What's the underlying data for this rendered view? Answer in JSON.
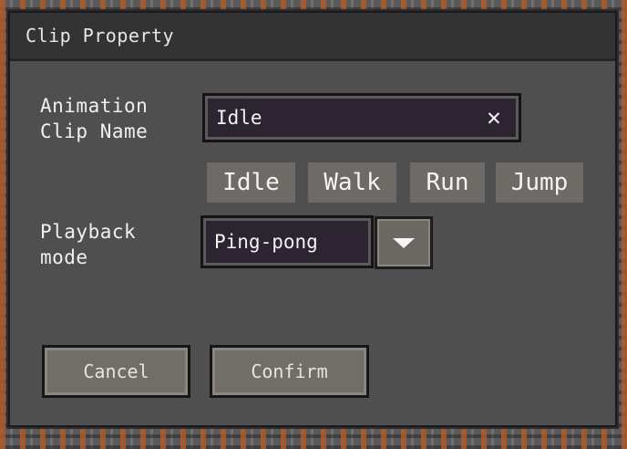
{
  "dialog": {
    "title": "Clip Property"
  },
  "clip_name": {
    "label_line1": "Animation",
    "label_line2": "Clip Name",
    "value": "Idle",
    "clear_icon": "close-icon"
  },
  "presets": [
    {
      "label": "Idle"
    },
    {
      "label": "Walk"
    },
    {
      "label": "Run"
    },
    {
      "label": "Jump"
    }
  ],
  "playback": {
    "label_line1": "Playback",
    "label_line2": "mode",
    "selected": "Ping-pong",
    "dropdown_icon": "chevron-down-icon"
  },
  "actions": {
    "cancel_label": "Cancel",
    "confirm_label": "Confirm"
  },
  "colors": {
    "panel": "#4f4f4f",
    "titlebar": "#333333",
    "input_bg": "#2c2430",
    "button_bg": "#716d67",
    "chip_bg": "#6e6a65",
    "text": "#f0f0f0"
  }
}
